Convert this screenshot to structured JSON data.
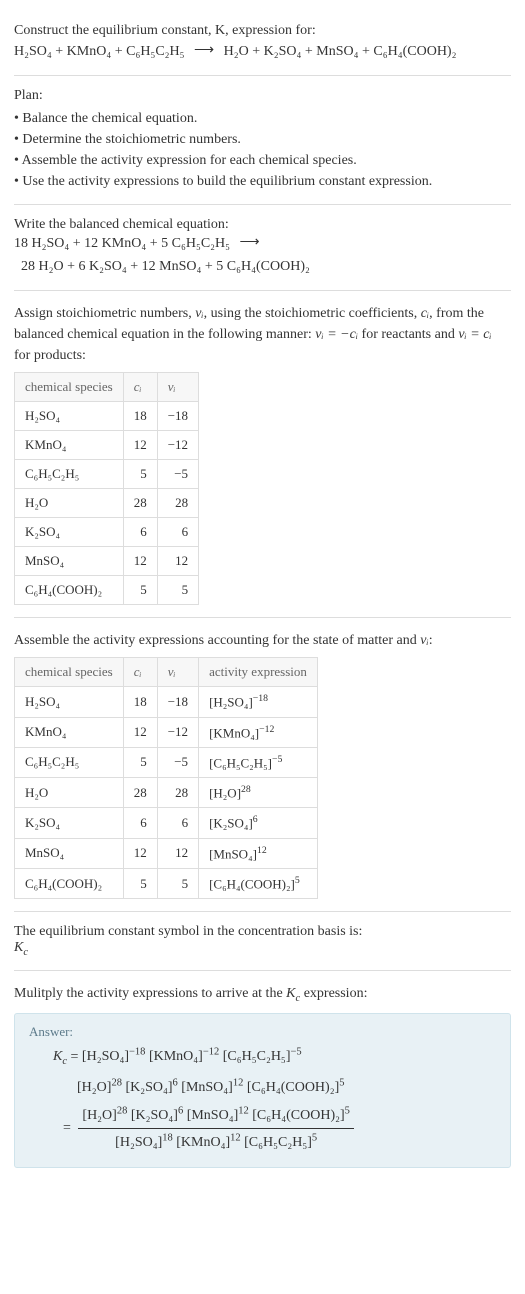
{
  "intro": {
    "line1": "Construct the equilibrium constant, K, expression for:",
    "equation_left": "H₂SO₄ + KMnO₄ + C₆H₅C₂H₅",
    "equation_right": "H₂O + K₂SO₄ + MnSO₄ + C₆H₄(COOH)₂"
  },
  "plan": {
    "heading": "Plan:",
    "items": [
      "Balance the chemical equation.",
      "Determine the stoichiometric numbers.",
      "Assemble the activity expression for each chemical species.",
      "Use the activity expressions to build the equilibrium constant expression."
    ]
  },
  "balanced": {
    "heading": "Write the balanced chemical equation:",
    "line1": "18 H₂SO₄ + 12 KMnO₄ + 5 C₆H₅C₂H₅",
    "line2": "28 H₂O + 6 K₂SO₄ + 12 MnSO₄ + 5 C₆H₄(COOH)₂"
  },
  "stoich": {
    "intro_a": "Assign stoichiometric numbers, ",
    "intro_b": ", using the stoichiometric coefficients, ",
    "intro_c": ", from the balanced chemical equation in the following manner: ",
    "intro_d": " for reactants and ",
    "intro_e": " for products:",
    "nu": "νᵢ",
    "ci": "cᵢ",
    "rel_reactants": "νᵢ = −cᵢ",
    "rel_products": "νᵢ = cᵢ",
    "headers": {
      "species": "chemical species",
      "ci": "cᵢ",
      "nu": "νᵢ"
    },
    "rows": [
      {
        "sp": "H₂SO₄",
        "c": "18",
        "n": "−18"
      },
      {
        "sp": "KMnO₄",
        "c": "12",
        "n": "−12"
      },
      {
        "sp": "C₆H₅C₂H₅",
        "c": "5",
        "n": "−5"
      },
      {
        "sp": "H₂O",
        "c": "28",
        "n": "28"
      },
      {
        "sp": "K₂SO₄",
        "c": "6",
        "n": "6"
      },
      {
        "sp": "MnSO₄",
        "c": "12",
        "n": "12"
      },
      {
        "sp": "C₆H₄(COOH)₂",
        "c": "5",
        "n": "5"
      }
    ]
  },
  "activity": {
    "intro_a": "Assemble the activity expressions accounting for the state of matter and ",
    "intro_b": ":",
    "headers": {
      "species": "chemical species",
      "ci": "cᵢ",
      "nu": "νᵢ",
      "act": "activity expression"
    },
    "rows": [
      {
        "sp": "H₂SO₄",
        "c": "18",
        "n": "−18",
        "base": "[H₂SO₄]",
        "exp": "−18"
      },
      {
        "sp": "KMnO₄",
        "c": "12",
        "n": "−12",
        "base": "[KMnO₄]",
        "exp": "−12"
      },
      {
        "sp": "C₆H₅C₂H₅",
        "c": "5",
        "n": "−5",
        "base": "[C₆H₅C₂H₅]",
        "exp": "−5"
      },
      {
        "sp": "H₂O",
        "c": "28",
        "n": "28",
        "base": "[H₂O]",
        "exp": "28"
      },
      {
        "sp": "K₂SO₄",
        "c": "6",
        "n": "6",
        "base": "[K₂SO₄]",
        "exp": "6"
      },
      {
        "sp": "MnSO₄",
        "c": "12",
        "n": "12",
        "base": "[MnSO₄]",
        "exp": "12"
      },
      {
        "sp": "C₆H₄(COOH)₂",
        "c": "5",
        "n": "5",
        "base": "[C₆H₄(COOH)₂]",
        "exp": "5"
      }
    ]
  },
  "symbol": {
    "text": "The equilibrium constant symbol in the concentration basis is:",
    "kc": "K",
    "kc_sub": "c"
  },
  "multiply": {
    "intro_a": "Mulitply the activity expressions to arrive at the ",
    "intro_b": " expression:"
  },
  "answer": {
    "label": "Answer:",
    "line1_terms": [
      {
        "b": "[H₂SO₄]",
        "e": "−18"
      },
      {
        "b": "[KMnO₄]",
        "e": "−12"
      },
      {
        "b": "[C₆H₅C₂H₅]",
        "e": "−5"
      }
    ],
    "line2_terms": [
      {
        "b": "[H₂O]",
        "e": "28"
      },
      {
        "b": "[K₂SO₄]",
        "e": "6"
      },
      {
        "b": "[MnSO₄]",
        "e": "12"
      },
      {
        "b": "[C₆H₄(COOH)₂]",
        "e": "5"
      }
    ],
    "frac_num": [
      {
        "b": "[H₂O]",
        "e": "28"
      },
      {
        "b": "[K₂SO₄]",
        "e": "6"
      },
      {
        "b": "[MnSO₄]",
        "e": "12"
      },
      {
        "b": "[C₆H₄(COOH)₂]",
        "e": "5"
      }
    ],
    "frac_den": [
      {
        "b": "[H₂SO₄]",
        "e": "18"
      },
      {
        "b": "[KMnO₄]",
        "e": "12"
      },
      {
        "b": "[C₆H₅C₂H₅]",
        "e": "5"
      }
    ]
  },
  "chart_data": {
    "type": "table",
    "tables": [
      {
        "title": "Stoichiometric numbers",
        "columns": [
          "chemical species",
          "cᵢ",
          "νᵢ"
        ],
        "rows": [
          [
            "H₂SO₄",
            18,
            -18
          ],
          [
            "KMnO₄",
            12,
            -12
          ],
          [
            "C₆H₅C₂H₅",
            5,
            -5
          ],
          [
            "H₂O",
            28,
            28
          ],
          [
            "K₂SO₄",
            6,
            6
          ],
          [
            "MnSO₄",
            12,
            12
          ],
          [
            "C₆H₄(COOH)₂",
            5,
            5
          ]
        ]
      },
      {
        "title": "Activity expressions",
        "columns": [
          "chemical species",
          "cᵢ",
          "νᵢ",
          "activity expression"
        ],
        "rows": [
          [
            "H₂SO₄",
            18,
            -18,
            "[H₂SO₄]^−18"
          ],
          [
            "KMnO₄",
            12,
            -12,
            "[KMnO₄]^−12"
          ],
          [
            "C₆H₅C₂H₅",
            5,
            -5,
            "[C₆H₅C₂H₅]^−5"
          ],
          [
            "H₂O",
            28,
            28,
            "[H₂O]^28"
          ],
          [
            "K₂SO₄",
            6,
            6,
            "[K₂SO₄]^6"
          ],
          [
            "MnSO₄",
            12,
            12,
            "[MnSO₄]^12"
          ],
          [
            "C₆H₄(COOH)₂",
            5,
            5,
            "[C₆H₄(COOH)₂]^5"
          ]
        ]
      }
    ]
  }
}
